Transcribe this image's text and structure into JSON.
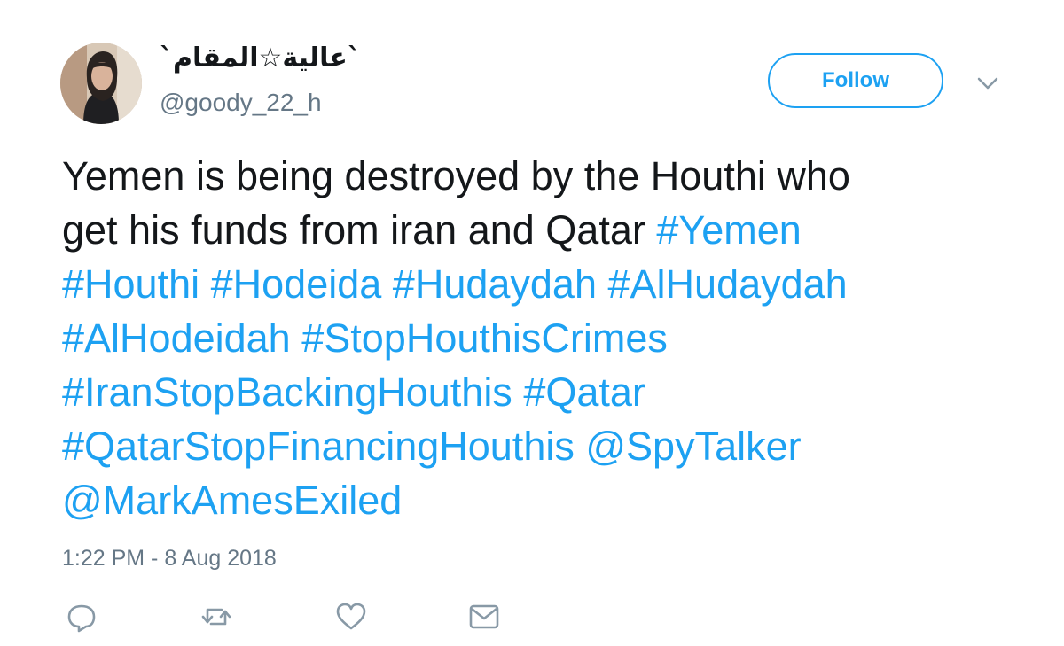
{
  "author": {
    "display_name": "`عالية☆المقام`",
    "handle": "@goody_22_h",
    "avatar_icon": "profile-photo"
  },
  "follow_button": {
    "label": "Follow"
  },
  "menu": {
    "icon": "chevron-down-icon"
  },
  "tweet": {
    "lines": [
      [
        {
          "text": "Yemen is being destroyed by the Houthi who",
          "type": "text"
        }
      ],
      [
        {
          "text": "get his funds from iran and Qatar ",
          "type": "text"
        },
        {
          "text": "#Yemen",
          "type": "tag"
        }
      ],
      [
        {
          "text": "#Houthi",
          "type": "tag"
        },
        {
          "text": " ",
          "type": "text"
        },
        {
          "text": "#Hodeida",
          "type": "tag"
        },
        {
          "text": " ",
          "type": "text"
        },
        {
          "text": "#Hudaydah",
          "type": "tag"
        },
        {
          "text": " ",
          "type": "text"
        },
        {
          "text": "#AlHudaydah",
          "type": "tag"
        }
      ],
      [
        {
          "text": "#AlHodeidah",
          "type": "tag"
        },
        {
          "text": " ",
          "type": "text"
        },
        {
          "text": "#StopHouthisCrimes",
          "type": "tag"
        }
      ],
      [
        {
          "text": "#IranStopBackingHouthis",
          "type": "tag"
        },
        {
          "text": " ",
          "type": "text"
        },
        {
          "text": "#Qatar",
          "type": "tag"
        }
      ],
      [
        {
          "text": "#QatarStopFinancingHouthis",
          "type": "tag"
        },
        {
          "text": " ",
          "type": "text"
        },
        {
          "text": "@SpyTalker",
          "type": "tag"
        }
      ],
      [
        {
          "text": "@MarkAmesExiled",
          "type": "tag"
        }
      ]
    ]
  },
  "timestamp": "1:22 PM - 8 Aug 2018",
  "actions": [
    {
      "name": "reply-icon"
    },
    {
      "name": "retweet-icon"
    },
    {
      "name": "like-icon"
    },
    {
      "name": "message-icon"
    }
  ],
  "colors": {
    "accent": "#1da1f2",
    "text": "#14171a",
    "secondary": "#657786"
  }
}
